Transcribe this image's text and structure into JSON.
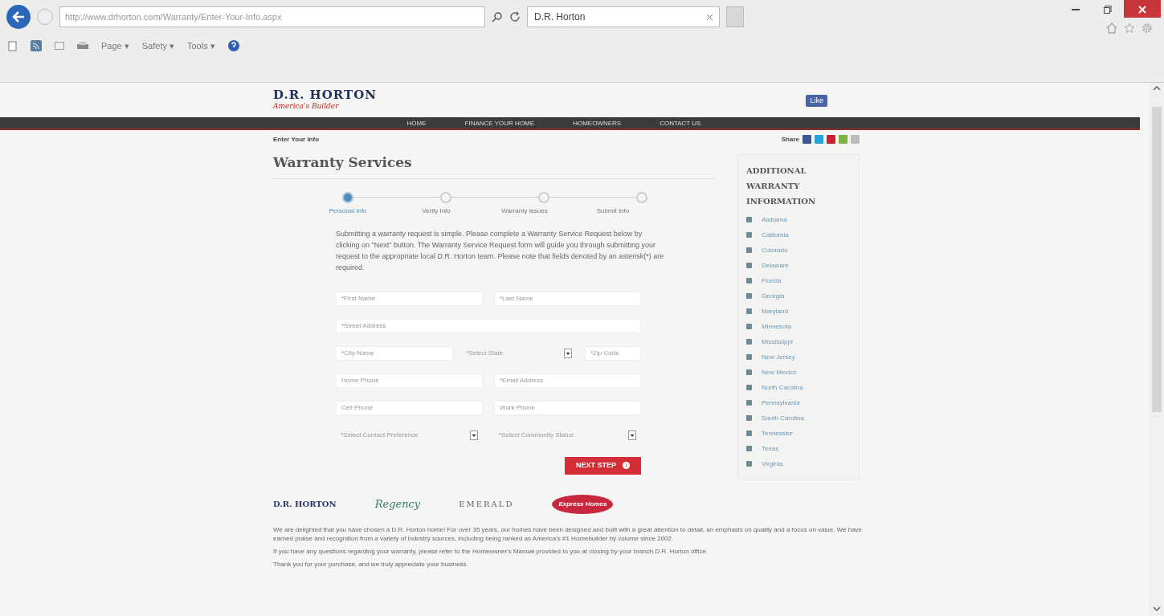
{
  "browser": {
    "address": "http://www.drhorton.com/Warranty/Enter-Your-Info.aspx",
    "tab": {
      "title": "D.R. Horton",
      "selected": true
    },
    "toolbar": [
      "Page ▾",
      "Safety ▾",
      "Tools ▾"
    ]
  },
  "header": {
    "logo": "D.R. HORTON",
    "tagline": "America's Builder",
    "like": "Like"
  },
  "nav": [
    "HOME",
    "FINANCE YOUR HOME",
    "HOMEOWNERS",
    "CONTACT US"
  ],
  "breadcrumb": "Enter Your Info",
  "share": "Share",
  "title": "Warranty Services",
  "steps": [
    {
      "label": "Personal Info",
      "selected": true
    },
    {
      "label": "Verify Info",
      "selected": false
    },
    {
      "label": "Warranty Issues",
      "selected": false
    },
    {
      "label": "Submit Info",
      "selected": false
    }
  ],
  "intro": "Submitting a warranty request is simple. Please complete a Warranty Service Request below by clicking on \"Next\" button. The Warranty Service Request form will guide you through submitting your request to the appropriate local D.R. Horton team. Please note that fields denoted by an asterisk(*) are required.",
  "form_rows": [
    [
      {
        "kind": "text",
        "placeholder": "*First Name"
      },
      {
        "kind": "text",
        "placeholder": "*Last Name"
      }
    ],
    [
      {
        "kind": "text",
        "placeholder": "*Street Address"
      }
    ],
    [
      {
        "kind": "text",
        "placeholder": "*City Name"
      },
      {
        "kind": "select",
        "value": "*Select State"
      },
      {
        "kind": "text",
        "placeholder": "*Zip Code"
      }
    ],
    [
      {
        "kind": "text",
        "placeholder": "Home Phone"
      },
      {
        "kind": "text",
        "placeholder": "*Email Address"
      }
    ],
    [
      {
        "kind": "text",
        "placeholder": "Cell Phone"
      },
      {
        "kind": "text",
        "placeholder": "Work Phone"
      }
    ],
    [
      {
        "kind": "select",
        "value": "*Select Contact Preference"
      },
      {
        "kind": "select",
        "value": "*Select Community Status"
      }
    ]
  ],
  "next_button": "NEXT STEP",
  "sidebar": {
    "title": "ADDITIONAL WARRANTY INFORMATION",
    "items": [
      "Alabama",
      "California",
      "Colorado",
      "Delaware",
      "Florida",
      "Georgia",
      "Maryland",
      "Minnesota",
      "Mississippi",
      "New Jersey",
      "New Mexico",
      "North Carolina",
      "Pennsylvania",
      "South Carolina",
      "Tennessee",
      "Texas",
      "Virginia"
    ]
  },
  "brands": [
    {
      "kind": "horton",
      "name": "D.R. HORTON"
    },
    {
      "kind": "script",
      "name": "Regency"
    },
    {
      "kind": "caps",
      "name": "EMERALD"
    },
    {
      "kind": "oval",
      "name": "Express Homes"
    }
  ],
  "footer": [
    "We are delighted that you have chosen a D.R. Horton home! For over 35 years, our homes have been designed and built with a great attention to detail, an emphasis on quality and a focus on value. We have earned praise and recognition from a variety of industry sources, including being ranked as America's #1 Homebuilder by volume since 2002.",
    "If you have any questions regarding your warranty, please refer to the Homeowner's Manual provided to you at closing by your branch D.R. Horton office.",
    "Thank you for your purchase, and we truly appreciate your business."
  ]
}
